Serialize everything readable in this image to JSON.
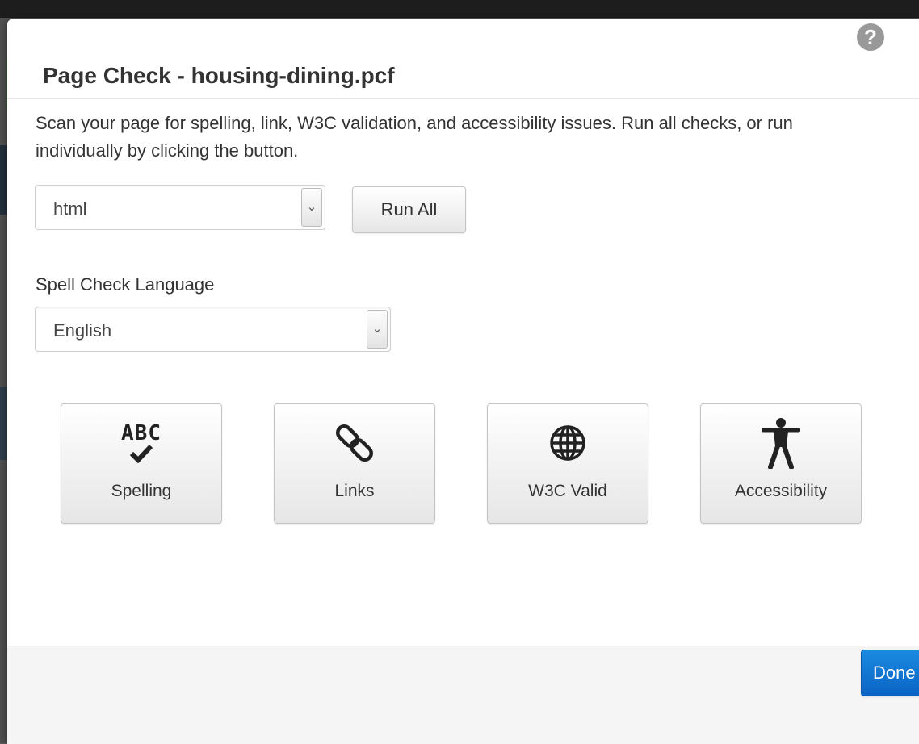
{
  "dialog": {
    "title": "Page Check - housing-dining.pcf",
    "help_icon": "question-circle-icon",
    "description": "Scan your page for spelling, link, W3C validation, and accessibility issues. Run all checks, or run individually by clicking the button.",
    "format_select": {
      "value": "html"
    },
    "run_all_label": "Run All",
    "spell_check_label": "Spell Check Language",
    "language_select": {
      "value": "English"
    },
    "checks": [
      {
        "label": "Spelling",
        "icon": "spellcheck-abc-icon"
      },
      {
        "label": "Links",
        "icon": "link-chain-icon"
      },
      {
        "label": "W3C Valid",
        "icon": "globe-icon"
      },
      {
        "label": "Accessibility",
        "icon": "accessibility-person-icon"
      }
    ],
    "spelling_icon_text": "ABC",
    "done_label": "Done"
  },
  "colors": {
    "primary_button": "#0b63c4",
    "overlay": "#4f4f4f"
  }
}
